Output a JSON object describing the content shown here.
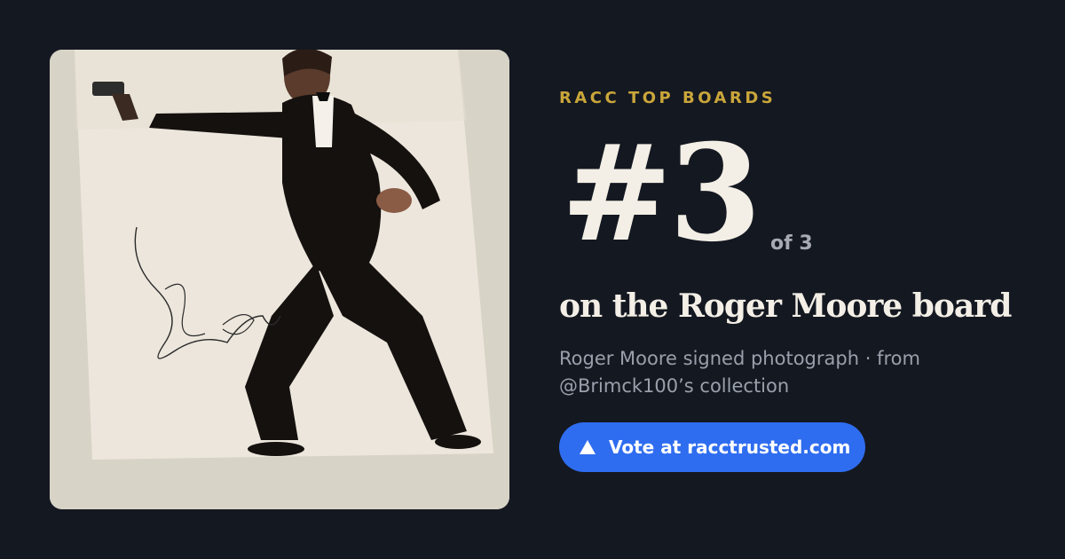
{
  "photo": {
    "alt": "Roger Moore signed photograph"
  },
  "kicker": "RACC TOP BOARDS",
  "rank": {
    "value": "#3",
    "of_label": "of 3"
  },
  "board_title": "on the Roger Moore board",
  "caption": "Roger Moore signed photograph · from @Brimck100’s collection",
  "vote_button": {
    "label": "Vote at racctrusted.com",
    "icon": "upvote-triangle-icon",
    "color": "#2f6df0"
  },
  "colors": {
    "background": "#141821",
    "accent": "#caa63a",
    "headline": "#f3efe6",
    "muted": "#9aa0ab"
  }
}
